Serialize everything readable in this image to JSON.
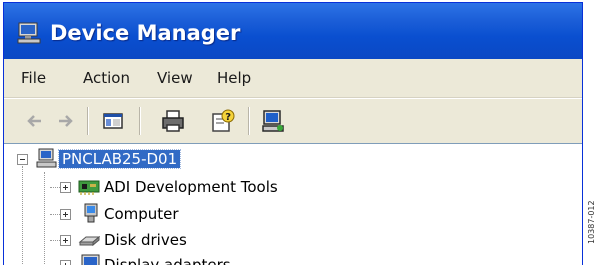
{
  "window": {
    "title": "Device Manager",
    "title_icon": "device-manager-icon",
    "colors": {
      "titlebar": "#0a4fd0",
      "menubar": "#ece9d8",
      "selection": "#316ac5"
    }
  },
  "menu": {
    "items": [
      "File",
      "Action",
      "View",
      "Help"
    ]
  },
  "toolbar": {
    "buttons": [
      "back-arrow-icon",
      "forward-arrow-icon",
      "console-tree-icon",
      "print-icon",
      "help-properties-icon",
      "computer-scan-icon"
    ]
  },
  "tree": {
    "root": {
      "label": "PNCLAB25-D01",
      "icon": "computer-icon",
      "expanded": true,
      "selected": true
    },
    "children": [
      {
        "label": "ADI Development Tools",
        "icon": "board-icon"
      },
      {
        "label": "Computer",
        "icon": "computer-icon"
      },
      {
        "label": "Disk drives",
        "icon": "disk-drive-icon"
      },
      {
        "label": "Display adapters",
        "icon": "display-adapter-icon"
      }
    ]
  },
  "caption": "10387-012"
}
